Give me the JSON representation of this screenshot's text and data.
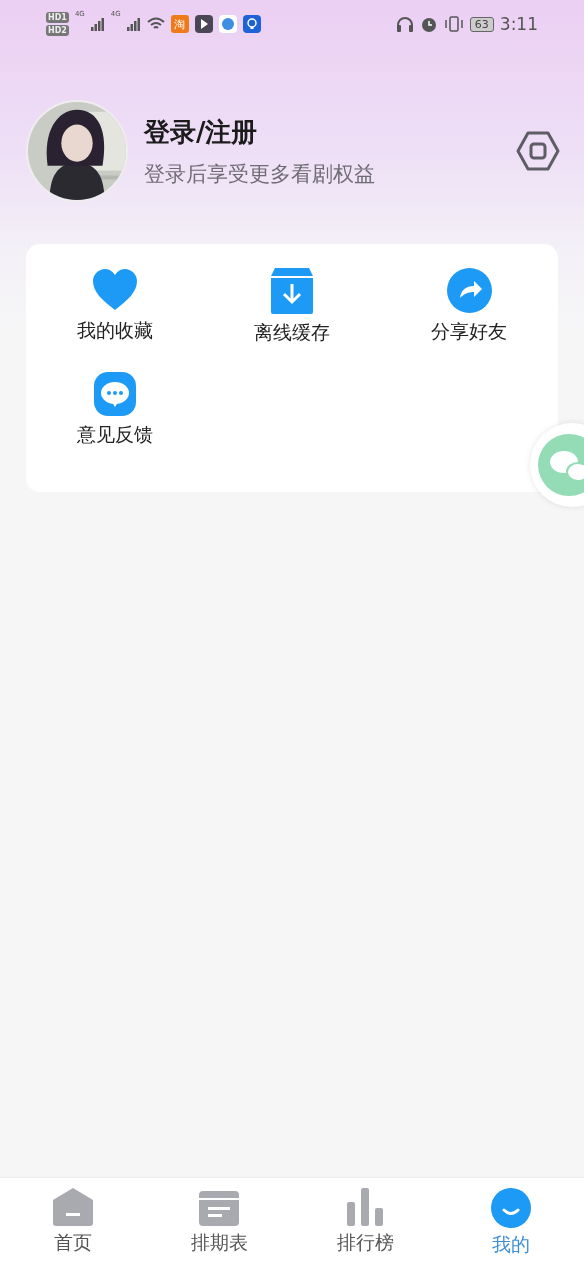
{
  "status_bar": {
    "sim_badges": [
      "HD1",
      "HD2"
    ],
    "network_labels": [
      "4G",
      "4G"
    ],
    "app_badge": "淘",
    "battery": "63",
    "time": "3:11"
  },
  "profile": {
    "title": "登录/注册",
    "subtitle": "登录后享受更多看剧权益"
  },
  "shortcuts": [
    {
      "kind": "heart",
      "label": "我的收藏"
    },
    {
      "kind": "download",
      "label": "离线缓存"
    },
    {
      "kind": "share",
      "label": "分享好友"
    },
    {
      "kind": "chat",
      "label": "意见反馈"
    }
  ],
  "tabs": [
    {
      "kind": "home",
      "label": "首页",
      "selected": false
    },
    {
      "kind": "calendar",
      "label": "排期表",
      "selected": false
    },
    {
      "kind": "chart",
      "label": "排行榜",
      "selected": false
    },
    {
      "kind": "me",
      "label": "我的",
      "selected": true
    }
  ]
}
